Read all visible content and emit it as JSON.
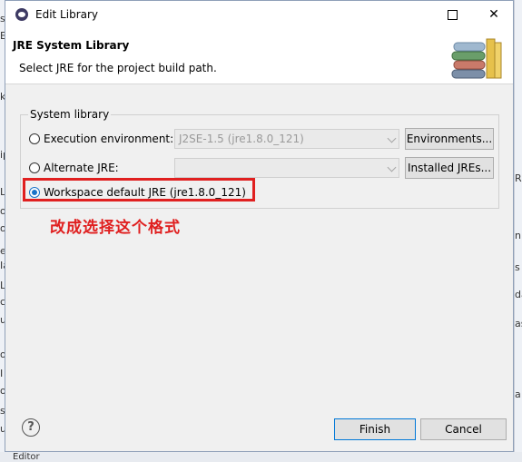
{
  "window": {
    "title": "Edit Library",
    "maximize_symbol": "□",
    "close_symbol": "✕"
  },
  "header": {
    "title": "JRE System Library",
    "description": "Select JRE for the project build path."
  },
  "group": {
    "label": "System library",
    "options": [
      {
        "label": "Execution environment:",
        "selected": false,
        "combo_value": "J2SE-1.5 (jre1.8.0_121)",
        "button": "Environments..."
      },
      {
        "label": "Alternate JRE:",
        "selected": false,
        "combo_value": "",
        "button": "Installed JREs..."
      },
      {
        "label": "Workspace default JRE (jre1.8.0_121)",
        "selected": true
      }
    ]
  },
  "annotation": "改成选择这个格式",
  "footer": {
    "help_symbol": "?",
    "finish_label": "Finish",
    "cancel_label": "Cancel"
  },
  "background_fragments": {
    "left": [
      "s",
      "E",
      "k",
      "ip",
      "ot",
      "L",
      "ot",
      "er",
      "Ia",
      "L",
      "cs",
      "u",
      "o",
      "I",
      "oc",
      "s",
      "u"
    ],
    "right": [
      "Rs",
      "nb",
      "s",
      "da",
      "as",
      "a"
    ],
    "bottom": "Editor"
  },
  "colors": {
    "accent": "#1a73c8",
    "annotation_red": "#e02020",
    "dialog_bg": "#f0f0f0"
  }
}
